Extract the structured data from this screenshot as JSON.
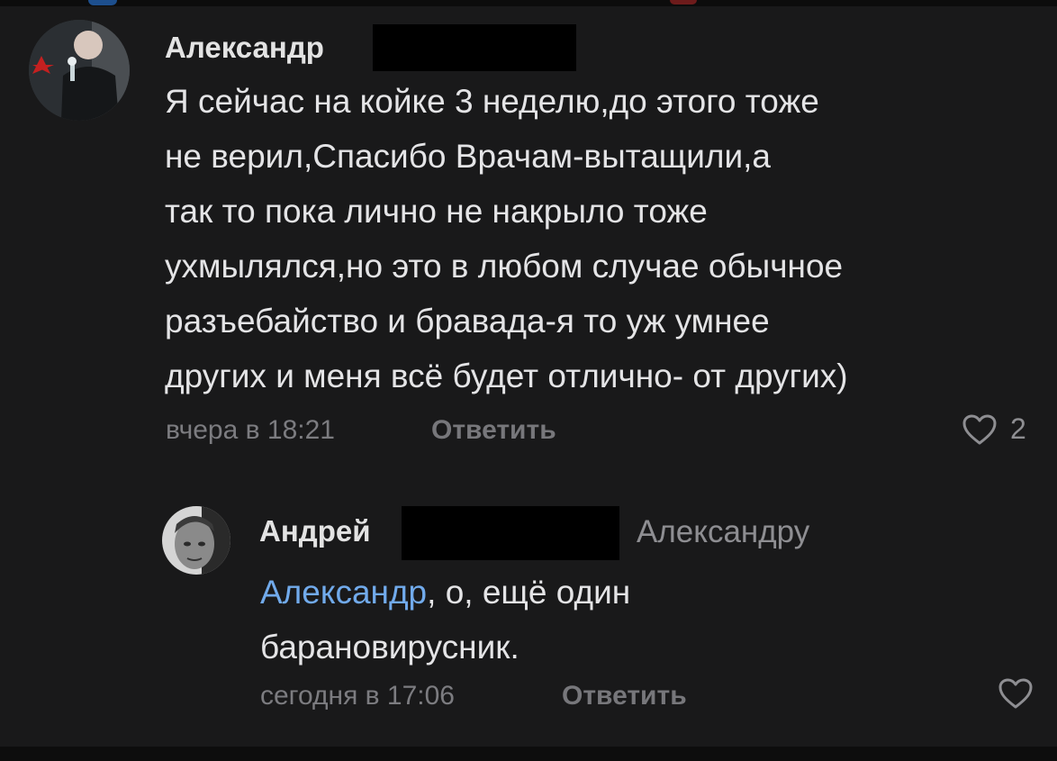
{
  "comments": [
    {
      "author": "Александр",
      "avatar_icon": "user-photo-avatar",
      "text_lines": [
        "Я сейчас на койке 3 неделю,до этого тоже",
        "не верил,Спасибо Врачам-вытащили,а",
        "так то пока лично не накрыло тоже",
        "ухмылялся,но это в любом случае обычное",
        "разъебайство и бравада-я то уж умнее",
        "других и меня всё будет отлично- от других)"
      ],
      "timestamp": "вчера в 18:21",
      "reply_label": "Ответить",
      "likes": "2",
      "like_icon": "heart-outline-icon"
    },
    {
      "author": "Андрей",
      "avatar_icon": "user-photo-avatar",
      "reply_to": "Александру",
      "mention": "Александр",
      "text_lines": [
        ", о, ещё один",
        "барановирусник."
      ],
      "timestamp": "сегодня в 17:06",
      "reply_label": "Ответить",
      "like_icon": "heart-outline-icon"
    }
  ],
  "colors": {
    "background": "#19191a",
    "text": "#e4e4e6",
    "secondary": "#7c7c80",
    "mention": "#71aaeb",
    "redaction": "#000000"
  }
}
